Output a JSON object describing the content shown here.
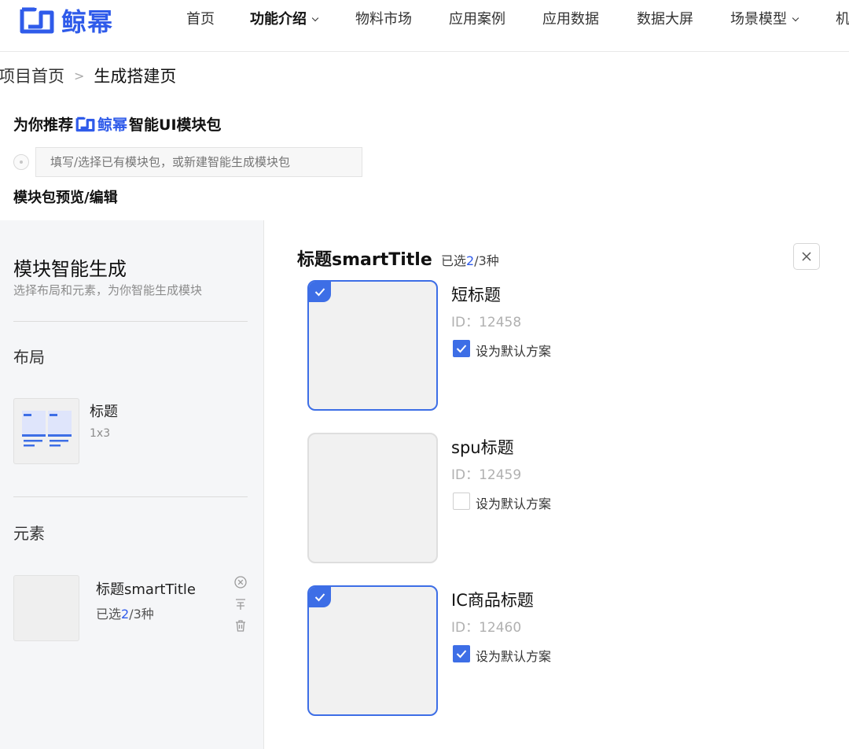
{
  "nav": {
    "logo_text": "鲸幂",
    "items": [
      {
        "label": "首页",
        "active": false,
        "has_dropdown": false
      },
      {
        "label": "功能介绍",
        "active": true,
        "has_dropdown": true
      },
      {
        "label": "物料市场",
        "active": false,
        "has_dropdown": false
      },
      {
        "label": "应用案例",
        "active": false,
        "has_dropdown": false
      },
      {
        "label": "应用数据",
        "active": false,
        "has_dropdown": false
      },
      {
        "label": "数据大屏",
        "active": false,
        "has_dropdown": false
      },
      {
        "label": "场景模型",
        "active": false,
        "has_dropdown": true
      },
      {
        "label": "机",
        "active": false,
        "has_dropdown": false
      }
    ]
  },
  "breadcrumb": {
    "home": "项目首页",
    "separator": ">",
    "current": "生成搭建页"
  },
  "recommend": {
    "prefix": "为你推荐",
    "brand": "鲸幂",
    "suffix": "智能UI模块包",
    "input_placeholder": "填写/选择已有模块包，或新建智能生成模块包"
  },
  "preview_title": "模块包预览/编辑",
  "left_panel": {
    "title": "模块智能生成",
    "subtitle": "选择布局和元素，为你智能生成模块",
    "layout_section": "布局",
    "layout": {
      "name": "标题",
      "spec": "1x3"
    },
    "element_section": "元素",
    "element": {
      "name": "标题smartTitle",
      "selected_prefix": "已选",
      "selected_count": "2",
      "selected_suffix": "/3种"
    }
  },
  "right_panel": {
    "title": "标题smartTitle",
    "count_prefix": "已选",
    "count_selected": "2",
    "count_suffix": "/3种",
    "options": [
      {
        "name": "短标题",
        "id": "ID：12458",
        "selected": true,
        "default_checked": true,
        "default_label": "设为默认方案"
      },
      {
        "name": "spu标题",
        "id": "ID：12459",
        "selected": false,
        "default_checked": false,
        "default_label": "设为默认方案"
      },
      {
        "name": "IC商品标题",
        "id": "ID：12460",
        "selected": true,
        "default_checked": true,
        "default_label": "设为默认方案"
      }
    ]
  },
  "colors": {
    "brand": "#2f5bea",
    "accent": "#3d6ee6",
    "panel_bg": "#f5f6f8"
  },
  "icons": {
    "logo": "logo-icon",
    "close": "close-icon",
    "check": "check-icon",
    "remove": "remove-circle-icon",
    "pin": "pin-icon",
    "trash": "trash-icon"
  }
}
